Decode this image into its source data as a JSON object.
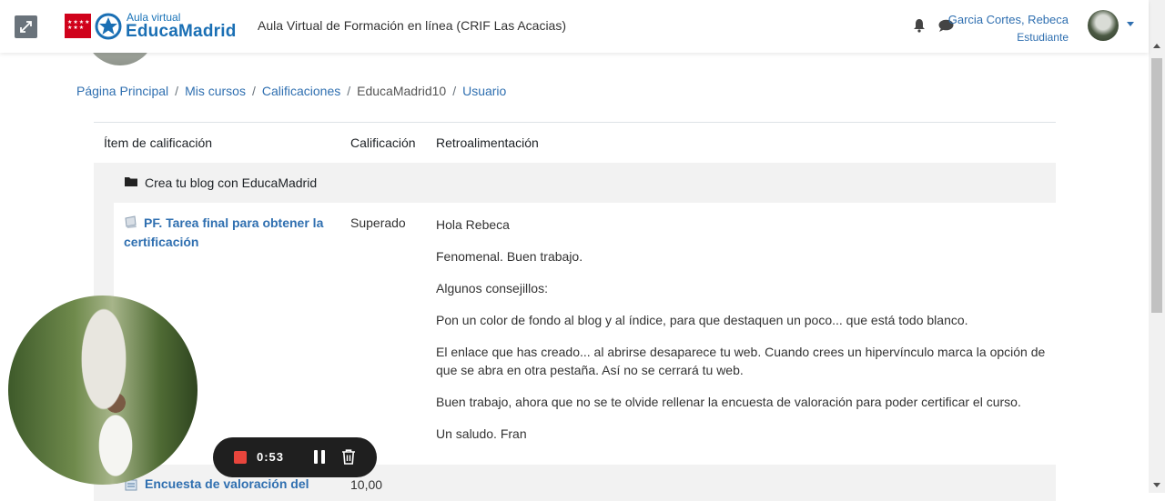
{
  "navbar": {
    "logo_small": "Aula virtual",
    "logo_big": "EducaMadrid",
    "site_title": "Aula Virtual de Formación en línea (CRIF Las Acacias)",
    "user_name": "Garcia Cortes, Rebeca",
    "user_role": "Estudiante"
  },
  "breadcrumb": {
    "items": [
      "Página Principal",
      "Mis cursos",
      "Calificaciones",
      "EducaMadrid10",
      "Usuario"
    ]
  },
  "table": {
    "headers": [
      "Ítem de calificación",
      "Calificación",
      "Retroalimentación"
    ],
    "category": "Crea tu blog con EducaMadrid",
    "item": {
      "name": "PF. Tarea final para obtener la certificación",
      "grade": "Superado",
      "feedback": [
        "Hola Rebeca",
        "Fenomenal. Buen trabajo.",
        "Algunos consejillos:",
        "Pon un color de fondo al blog y al índice, para que destaquen un poco... que está todo blanco.",
        "El enlace que has creado... al abrirse desaparece tu web. Cuando crees un hipervínculo marca la opción de que se abra en otra pestaña. Así no se cerrará tu web.",
        "Buen trabajo, ahora que no se te olvide rellenar la encuesta de valoración para poder certificar el curso.",
        "Un saludo. Fran"
      ]
    },
    "next_item": {
      "name": "Encuesta de valoración del",
      "grade": "10,00"
    }
  },
  "recorder": {
    "time": "0:53"
  },
  "colors": {
    "link": "#2f6fb0",
    "madrid_red": "#d0021b",
    "record_red": "#e8453c"
  }
}
